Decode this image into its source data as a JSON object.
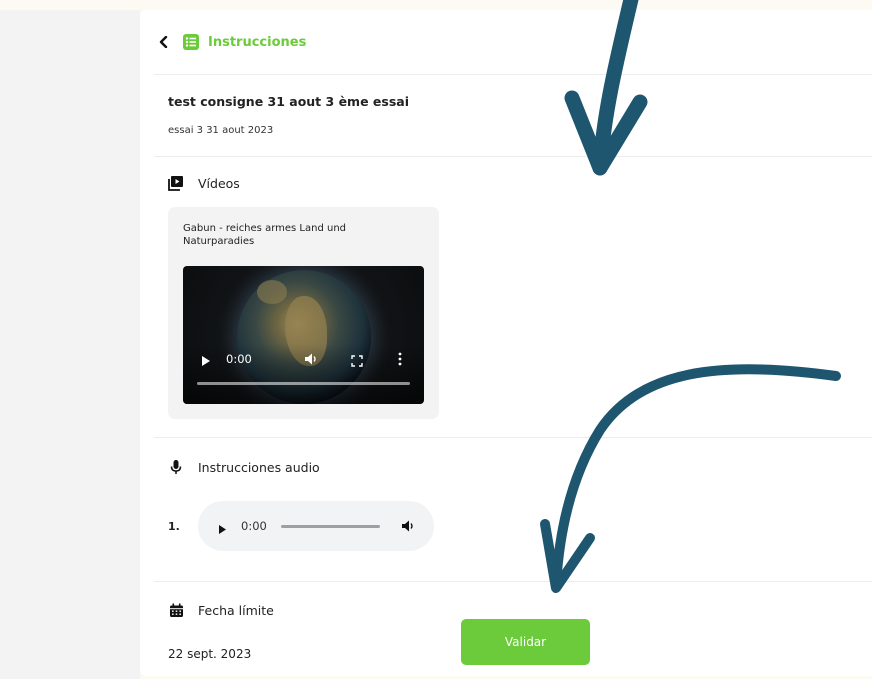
{
  "header": {
    "title": "Instrucciones",
    "accent_color": "#6bcb3a",
    "back_icon": "chevron-left-icon",
    "app_icon": "list-icon"
  },
  "consigne": {
    "title": "test consigne 31 aout 3 ème essai",
    "subtitle": "essai 3 31 aout 2023"
  },
  "videos": {
    "section_label": "Vídeos",
    "section_icon": "video-library-icon",
    "items": [
      {
        "title": "Gabun - reiches armes Land und Naturparadies",
        "current_time": "0:00"
      }
    ]
  },
  "audio": {
    "section_label": "Instrucciones audio",
    "section_icon": "microphone-icon",
    "items": [
      {
        "index": "1.",
        "current_time": "0:00"
      }
    ]
  },
  "deadline": {
    "section_label": "Fecha límite",
    "section_icon": "calendar-icon",
    "date": "22 sept. 2023"
  },
  "actions": {
    "validate_label": "Validar"
  },
  "annotation_color": "#1e5670"
}
